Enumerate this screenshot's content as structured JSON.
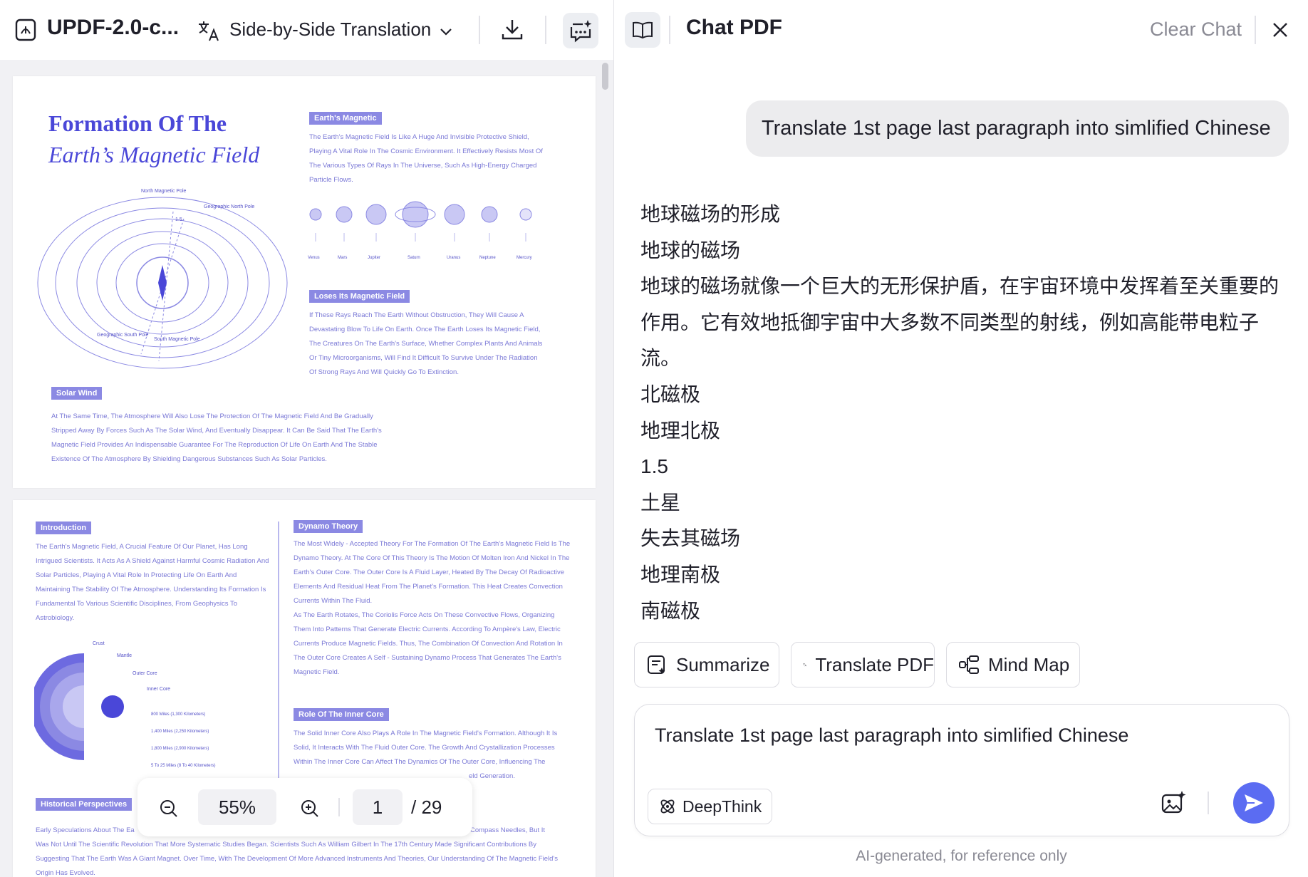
{
  "toolbar": {
    "file_name": "UPDF-2.0-c...",
    "mode_label": "Side-by-Side Translation"
  },
  "pdf": {
    "page1": {
      "title_line1": "Formation Of The",
      "title_line2": "Earth’s Magnetic Field",
      "tag_magnetic": "Earth's Magnetic",
      "text_magnetic": "The Earth's Magnetic Field Is Like A Huge And Invisible Protective Shield, Playing A Vital Role In The Cosmic Environment. It Effectively Resists Most Of The Various Types Of Rays In The Universe, Such As High-Energy Charged Particle Flows.",
      "planets": [
        "Venus",
        "Mars",
        "Jupiter",
        "Saturn",
        "Uranus",
        "Neptune",
        "Mercury"
      ],
      "diagram_labels": {
        "north_magnetic": "North Magnetic Pole",
        "geographic_north": "Geographic North Pole",
        "angle": "1.5",
        "geographic_south": "Geographic South Pole",
        "south_magnetic": "South Magnetic Pole"
      },
      "tag_loses": "Loses Its Magnetic Field",
      "text_loses": "If These Rays Reach The Earth Without Obstruction, They Will Cause A Devastating Blow To Life On Earth. Once The Earth Loses Its Magnetic Field, The Creatures On The Earth's Surface, Whether Complex Plants And Animals Or Tiny Microorganisms, Will Find It Difficult To Survive Under The Radiation Of Strong Rays And Will Quickly Go To Extinction.",
      "tag_solar": "Solar Wind",
      "text_solar": "At The Same Time, The Atmosphere Will Also Lose The Protection Of The Magnetic Field And Be Gradually Stripped Away By Forces Such As The Solar Wind, And Eventually Disappear. It Can Be Said That The Earth's Magnetic Field Provides An Indispensable Guarantee For The Reproduction Of Life On Earth And The Stable Existence Of The Atmosphere By Shielding Dangerous Substances Such As Solar Particles."
    },
    "page2": {
      "tag_intro": "Introduction",
      "text_intro": "The Earth's Magnetic Field, A Crucial Feature Of Our Planet, Has Long Intrigued Scientists. It Acts As A Shield Against Harmful Cosmic Radiation And Solar Particles, Playing A Vital Role In Protecting Life On Earth And Maintaining The Stability Of The Atmosphere. Understanding Its Formation Is Fundamental To Various Scientific Disciplines, From Geophysics To Astrobiology.",
      "layer_labels": {
        "crust": "Crust",
        "mantle": "Mantle",
        "outer_core": "Outer Core",
        "inner_core": "Inner Core",
        "d1": "800 Miles (1,300 Kilometers)",
        "d2": "1,400 Miles (2,250 Kilometers)",
        "d3": "1,800 Miles (2,900 Kilometers)",
        "d4": "5 To 25 Miles (8 To 40 Kilometers)"
      },
      "tag_dynamo": "Dynamo Theory",
      "text_dynamo": "The Most Widely - Accepted Theory For The Formation Of The Earth's Magnetic Field Is The Dynamo Theory. At The Core Of This Theory Is The Motion Of Molten Iron And Nickel In The Earth's Outer Core. The Outer Core Is A Fluid Layer, Heated By The Decay Of Radioactive Elements And Residual Heat From The Planet's Formation. This Heat Creates Convection Currents Within The Fluid.",
      "text_dynamo2": "As The Earth Rotates, The Coriolis Force Acts On These Convective Flows, Organizing Them Into Patterns That Generate Electric Currents. According To Ampère's Law, Electric Currents Produce Magnetic Fields. Thus, The Combination Of Convection And Rotation In The Outer Core Creates A Self - Sustaining Dynamo Process That Generates The Earth's Magnetic Field.",
      "tag_inner": "Role Of The Inner Core",
      "text_inner": "The Solid Inner Core Also Plays A Role In The Magnetic Field's Formation. Although It Is Solid, It Interacts With The Fluid Outer Core. The Growth And Crystallization Processes Within The Inner Core Can Affect The Dynamics Of The Outer Core, Influencing The",
      "text_inner_tail": "eld Generation.",
      "tag_hist": "Historical Perspectives",
      "text_hist_a": "Early Speculations About The Ea",
      "text_hist_b": "Compass Needles, But It",
      "text_hist_c": "Was Not Until The Scientific Revolution That More Systematic Studies Began. Scientists Such As William Gilbert In The 17th Century Made Significant Contributions By Suggesting That The Earth Was A Giant Magnet. Over Time, With The Development Of More Advanced Instruments And Theories, Our Understanding Of The Magnetic Field's Origin Has Evolved."
    }
  },
  "zoom": {
    "value": "55%",
    "page_current": "1",
    "page_total": "/ 29"
  },
  "chat": {
    "title": "Chat PDF",
    "clear_label": "Clear Chat",
    "user_message": "Translate 1st page last paragraph into simlified Chinese",
    "reply_lines": [
      "地球磁场的形成",
      "地球的磁场",
      "地球的磁场就像一个巨大的无形保护盾，在宇宙环境中发挥着至关重要的作用。它有效地抵御宇宙中大多数不同类型的射线，例如高能带电粒子流。",
      "北磁极",
      "地理北极",
      "1.5",
      "土星",
      "失去其磁场",
      "地理南极",
      "南磁极"
    ],
    "actions": {
      "summarize": "Summarize",
      "translate": "Translate PDF",
      "mindmap": "Mind Map"
    },
    "input_value": "Translate 1st page last paragraph into simlified Chinese",
    "deepthink_label": "DeepThink",
    "disclaimer": "AI-generated, for reference only"
  },
  "colors": {
    "accent": "#5b6cf2",
    "pdf_purple": "#4a47d8"
  }
}
